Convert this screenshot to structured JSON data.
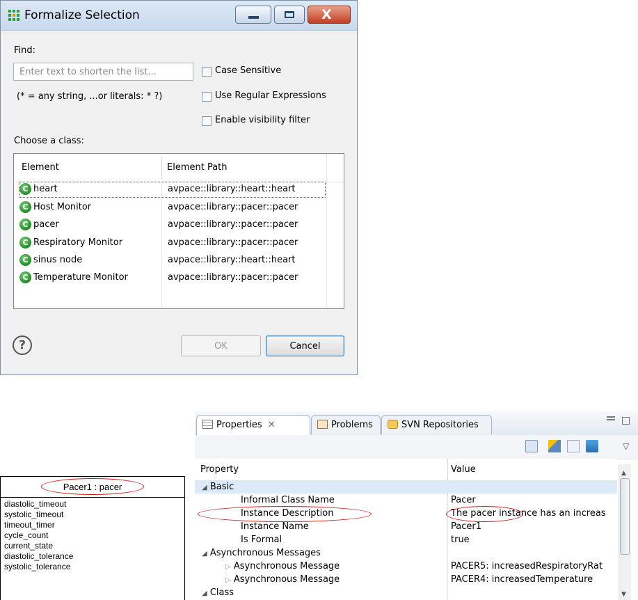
{
  "dialog": {
    "title": "Formalize Selection",
    "find_label": "Find:",
    "find_placeholder": "Enter text to shorten the list...",
    "wildcard_hint": "(* = any string, ...or literals: * ?)",
    "case_sensitive": "Case Sensitive",
    "use_regex": "Use Regular Expressions",
    "visibility_filter": "Enable visibility filter",
    "choose_label": "Choose a class:",
    "columns": [
      "Element",
      "Element Path"
    ],
    "rows": [
      {
        "element": "heart",
        "path": "avpace::library::heart::heart",
        "icon": "C"
      },
      {
        "element": "Host Monitor",
        "path": "avpace::library::pacer::pacer",
        "icon": "C"
      },
      {
        "element": "pacer",
        "path": "avpace::library::pacer::pacer",
        "icon": "C"
      },
      {
        "element": "Respiratory Monitor",
        "path": "avpace::library::pacer::pacer",
        "icon": "C"
      },
      {
        "element": "sinus node",
        "path": "avpace::library::heart::heart",
        "icon": "C"
      },
      {
        "element": "Temperature Monitor",
        "path": "avpace::library::pacer::pacer",
        "icon": "C"
      }
    ],
    "ok_label": "OK",
    "cancel_label": "Cancel",
    "help_glyph": "?"
  },
  "diagram": {
    "title": "Pacer1 : pacer",
    "attributes": [
      "diastolic_timeout",
      "systolic_timeout",
      "timeout_timer",
      "cycle_count",
      "current_state",
      "diastolic_tolerance",
      "systolic_tolerance"
    ]
  },
  "properties": {
    "tabs": {
      "properties": "Properties",
      "close_glyph": "✕",
      "problems": "Problems",
      "svn": "SVN Repositories"
    },
    "columns": {
      "property": "Property",
      "value": "Value"
    },
    "rows": [
      {
        "label": "Basic",
        "value": ""
      },
      {
        "label": "Informal Class Name",
        "value": "Pacer"
      },
      {
        "label": "Instance Description",
        "value": "The pacer instance has an increas"
      },
      {
        "label": "Instance Name",
        "value": "Pacer1"
      },
      {
        "label": "Is Formal",
        "value": "true"
      },
      {
        "label": "Asynchronous Messages",
        "value": ""
      },
      {
        "label": "Asynchronous Message",
        "value": "PACER5: increasedRespiratoryRat"
      },
      {
        "label": "Asynchronous Message",
        "value": "PACER4: increasedTemperature"
      },
      {
        "label": "Class",
        "value": ""
      }
    ]
  },
  "colors": {
    "selection": "#dceaf8",
    "annotation_red": "#d01818",
    "class_icon_green": "#1f8a24"
  }
}
